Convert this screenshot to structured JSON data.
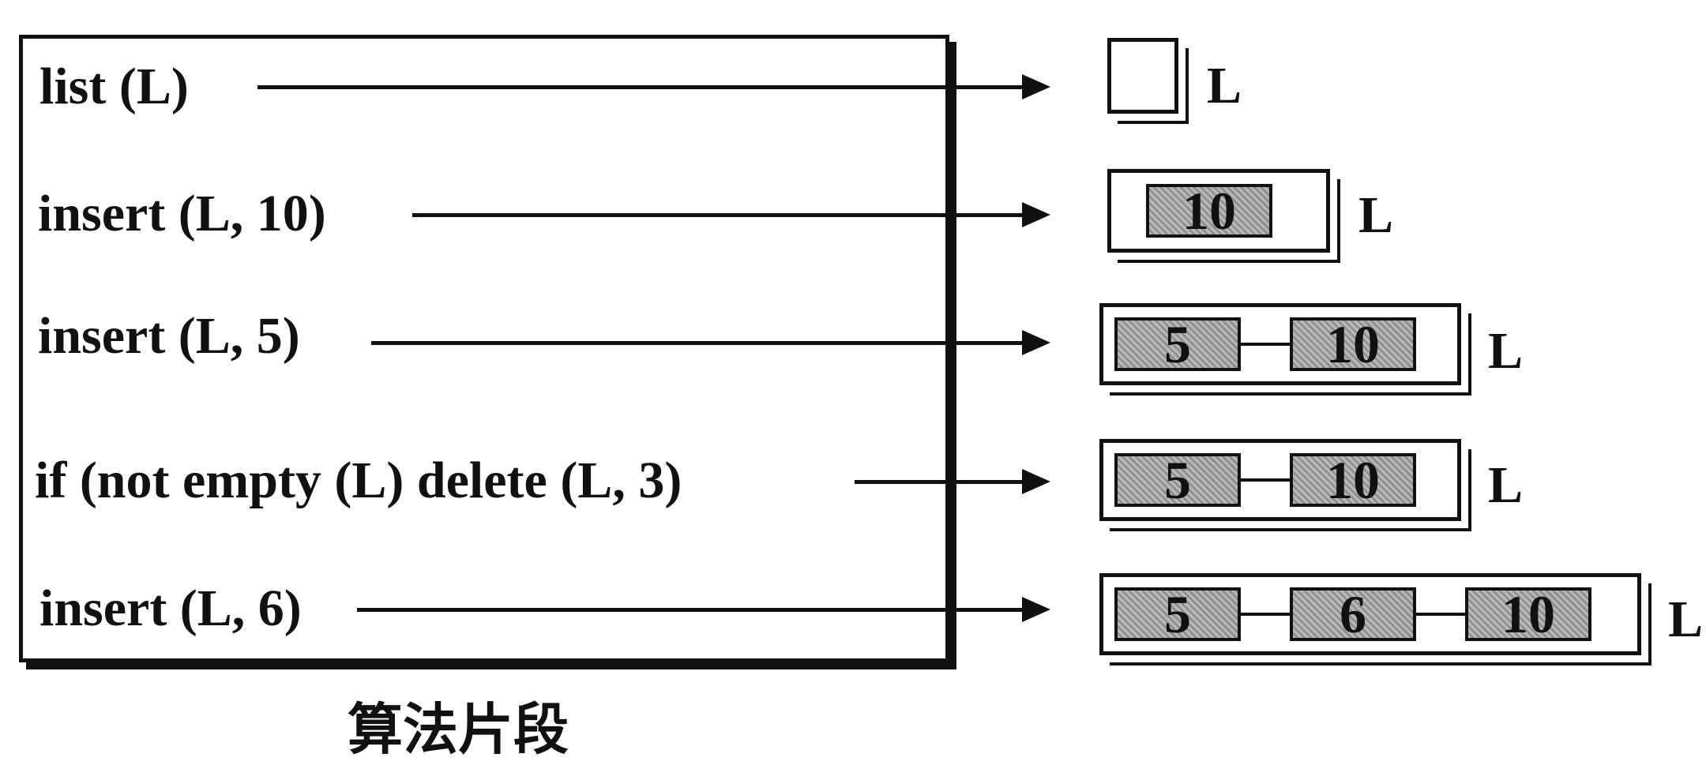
{
  "caption": "算法片段",
  "operations": [
    {
      "text": "list (L)",
      "list_label": "L",
      "values": []
    },
    {
      "text": "insert (L, 10)",
      "list_label": "L",
      "values": [
        "10"
      ]
    },
    {
      "text": "insert (L, 5)",
      "list_label": "L",
      "values": [
        "5",
        "10"
      ]
    },
    {
      "text": "if (not empty (L)    delete (L, 3)",
      "list_label": "L",
      "values": [
        "5",
        "10"
      ]
    },
    {
      "text": "insert (L, 6)",
      "list_label": "L",
      "values": [
        "5",
        "6",
        "10"
      ]
    }
  ]
}
